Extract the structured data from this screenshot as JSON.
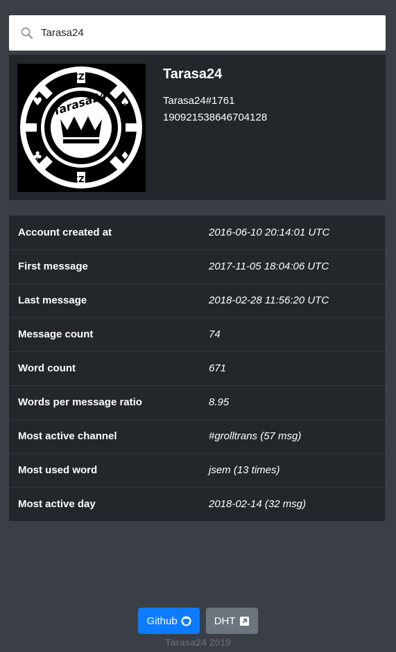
{
  "search": {
    "value": "Tarasa24",
    "icon": "search-icon"
  },
  "profile": {
    "username": "Tarasa24",
    "tag": "Tarasa24#1761",
    "user_id": "190921538646704128",
    "avatar": {
      "ring_text": "Tarasa24",
      "top_text": "CZE",
      "bottom_text": "CZE"
    }
  },
  "stats": [
    {
      "label": "Account created at",
      "value": "2016-06-10 20:14:01 UTC"
    },
    {
      "label": "First message",
      "value": "2017-11-05 18:04:06 UTC"
    },
    {
      "label": "Last message",
      "value": "2018-02-28 11:56:20 UTC"
    },
    {
      "label": "Message count",
      "value": "74"
    },
    {
      "label": "Word count",
      "value": "671"
    },
    {
      "label": "Words per message ratio",
      "value": "8.95"
    },
    {
      "label": "Most active channel",
      "value": "#grolltrans (57 msg)"
    },
    {
      "label": "Most used word",
      "value": "jsem (13 times)"
    },
    {
      "label": "Most active day",
      "value": "2018-02-14 (32 msg)"
    }
  ],
  "footer": {
    "github_label": "Github",
    "github_icon": "github-icon",
    "dht_label": "DHT",
    "dht_icon": "external-link-icon",
    "copyright": "Tarasa24 2019"
  },
  "colors": {
    "page_bg": "#3a3f46",
    "card_bg": "#23262b",
    "github_button": "#0d7bff",
    "dht_button": "#6c757d"
  }
}
